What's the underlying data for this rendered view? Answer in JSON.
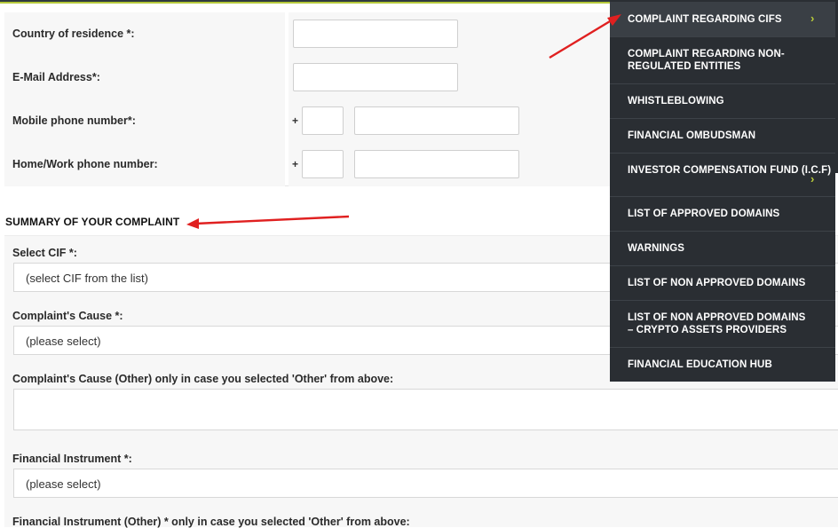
{
  "contact": {
    "country_label": "Country of residence *:",
    "email_label": "E-Mail Address*:",
    "mobile_label": "Mobile phone number*:",
    "home_label": "Home/Work phone number:",
    "plus_sign": "+"
  },
  "summary": {
    "heading": "SUMMARY OF YOUR COMPLAINT",
    "select_cif_label": "Select CIF *:",
    "select_cif_value": "(select CIF from the list)",
    "cause_label": "Complaint's Cause *:",
    "cause_value": "(please select)",
    "cause_other_label": "Complaint's Cause (Other) only in case you selected 'Other' from above:",
    "instrument_label": "Financial Instrument *:",
    "instrument_value": "(please select)",
    "instrument_other_label": "Financial Instrument (Other) * only in case you selected 'Other' from above:"
  },
  "menu": {
    "items": [
      {
        "label": "COMPLAINT REGARDING CIFS"
      },
      {
        "label": "COMPLAINT REGARDING NON-REGULATED ENTITIES"
      },
      {
        "label": "WHISTLEBLOWING"
      },
      {
        "label": "FINANCIAL OMBUDSMAN"
      },
      {
        "label": "INVESTOR COMPENSATION FUND (I.C.F)"
      },
      {
        "label": "LIST OF APPROVED DOMAINS"
      },
      {
        "label": "WARNINGS"
      },
      {
        "label": "LIST OF NON APPROVED DOMAINS"
      },
      {
        "label": "LIST OF NON APPROVED DOMAINS – CRYPTO ASSETS PROVIDERS"
      },
      {
        "label": "FINANCIAL EDUCATION HUB"
      }
    ],
    "chevron_glyph": "›"
  },
  "colors": {
    "accent_green": "#b5c93a",
    "menu_bg": "#2a2e33",
    "annotation_arrow": "#e02020"
  },
  "icons": [
    "chevron-right-icon",
    "annotation-arrow-icon"
  ]
}
